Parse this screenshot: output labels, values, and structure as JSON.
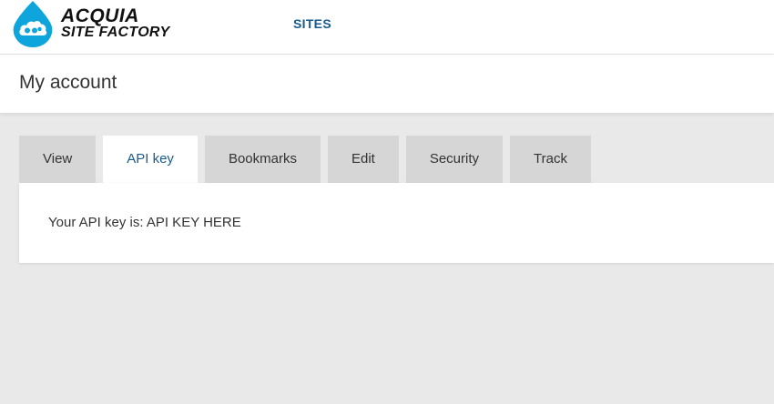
{
  "header": {
    "logo": {
      "line1": "ACQUIA",
      "line2": "SITE FACTORY",
      "icon": "cloud-drop-icon",
      "color": "#0ea5dd"
    },
    "nav": {
      "sites_label": "SITES"
    },
    "accent_color": "#1a5b8e"
  },
  "page": {
    "title": "My account"
  },
  "tabs": [
    {
      "label": "View",
      "active": false
    },
    {
      "label": "API key",
      "active": true
    },
    {
      "label": "Bookmarks",
      "active": false
    },
    {
      "label": "Edit",
      "active": false
    },
    {
      "label": "Security",
      "active": false
    },
    {
      "label": "Track",
      "active": false
    }
  ],
  "content": {
    "api_text": "Your API key is: API KEY HERE"
  }
}
